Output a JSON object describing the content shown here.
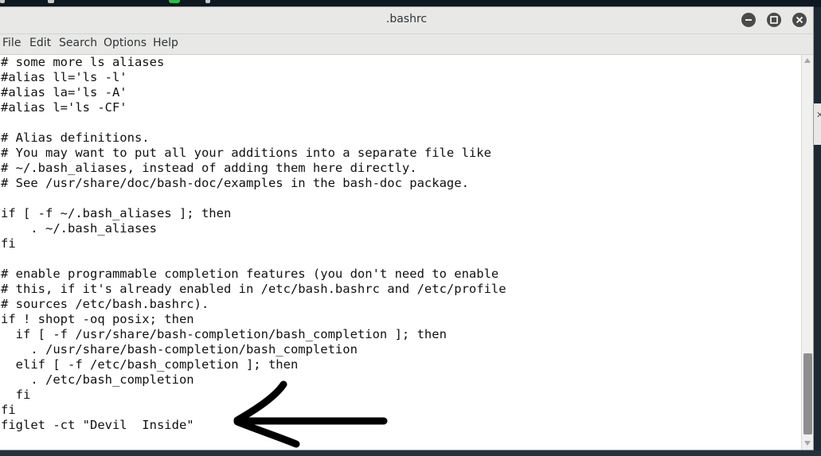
{
  "window": {
    "title": ".bashrc"
  },
  "menubar": {
    "items": [
      "File",
      "Edit",
      "Search",
      "Options",
      "Help"
    ]
  },
  "editor": {
    "lines": [
      "# some more ls aliases",
      "#alias ll='ls -l'",
      "#alias la='ls -A'",
      "#alias l='ls -CF'",
      "",
      "# Alias definitions.",
      "# You may want to put all your additions into a separate file like",
      "# ~/.bash_aliases, instead of adding them here directly.",
      "# See /usr/share/doc/bash-doc/examples in the bash-doc package.",
      "",
      "if [ -f ~/.bash_aliases ]; then",
      "    . ~/.bash_aliases",
      "fi",
      "",
      "# enable programmable completion features (you don't need to enable",
      "# this, if it's already enabled in /etc/bash.bashrc and /etc/profile",
      "# sources /etc/bash.bashrc).",
      "if ! shopt -oq posix; then",
      "  if [ -f /usr/share/bash-completion/bash_completion ]; then",
      "    . /usr/share/bash-completion/bash_completion",
      "  elif [ -f /etc/bash_completion ]; then",
      "    . /etc/bash_completion",
      "  fi",
      "fi",
      "figlet -ct \"Devil  Inside\""
    ]
  },
  "icons": {
    "minimize": "minimize-icon",
    "maximize": "maximize-icon",
    "close": "close-icon",
    "annotation": "hand-drawn-arrow"
  },
  "colors": {
    "titlebar": "#e8e8e7",
    "button": "#4a4a4a",
    "text": "#111111",
    "scroll_thumb": "#8e8e8e"
  }
}
